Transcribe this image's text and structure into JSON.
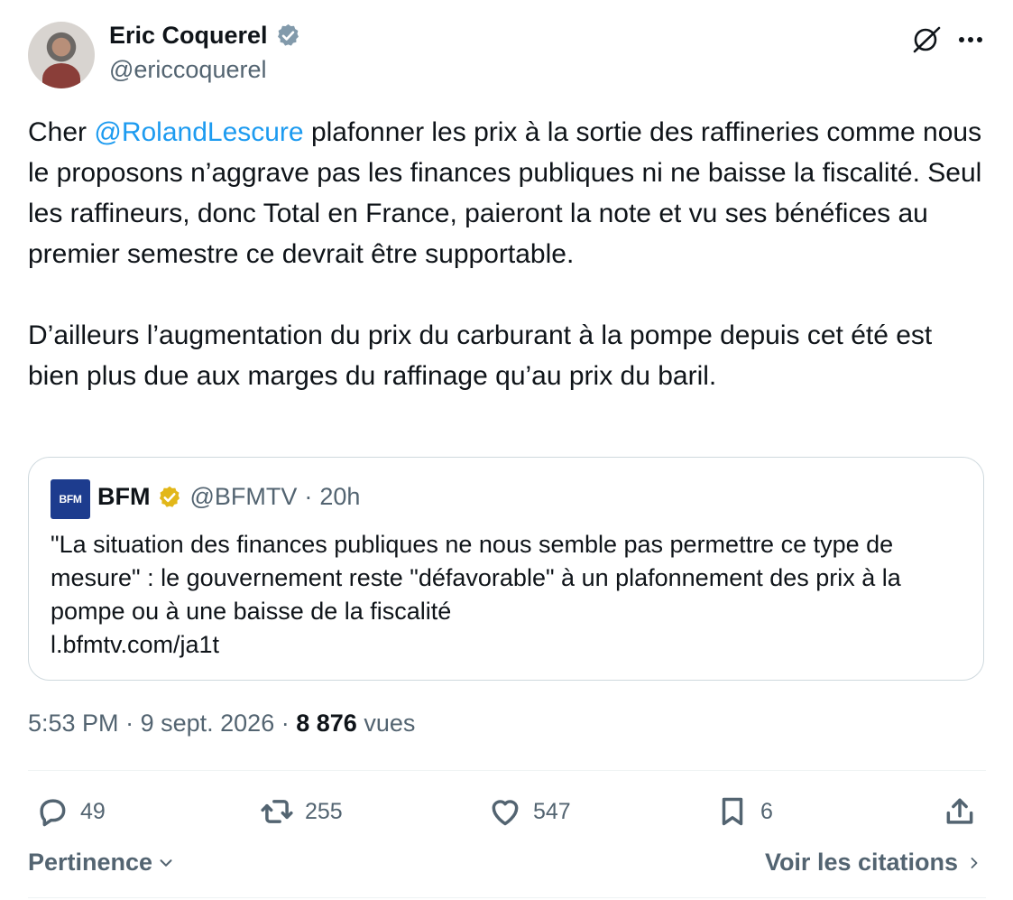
{
  "author": {
    "name": "Eric Coquerel",
    "handle": "@ericcoquerel",
    "verified_color": "#829aab"
  },
  "tweet": {
    "prefix": "Cher ",
    "mention": "@RolandLescure",
    "body": " plafonner les prix à la sortie des raffineries comme nous le proposons n’aggrave pas les finances publiques ni ne baisse la fiscalité. Seul les raffineurs, donc Total en France, paieront la note et vu ses bénéfices au premier semestre ce devrait être supportable.\n\nD’ailleurs l’augmentation du prix du carburant à la pompe depuis cet été est bien plus due aux marges du raffinage qu’au prix du baril."
  },
  "quote": {
    "logo_text": "BFM",
    "name": "BFM",
    "handle": "@BFMTV",
    "separator": "·",
    "time": "20h",
    "text": "\"La situation des finances publiques ne nous semble pas permettre ce type de mesure\" : le gouvernement reste \"défavorable\" à un plafonnement des prix à la pompe ou à une baisse de la fiscalité\nl.bfmtv.com/ja1t",
    "verified_color": "#e2b719"
  },
  "meta": {
    "time": "5:53 PM",
    "date": "9 sept. 2026",
    "separator": "·",
    "views_count": "8 876",
    "views_label": "vues"
  },
  "actions": {
    "replies": "49",
    "reposts": "255",
    "likes": "547",
    "bookmarks": "6"
  },
  "footer": {
    "sort_label": "Pertinence",
    "quotes_label": "Voir les citations"
  },
  "colors": {
    "accent": "#1d9bf0",
    "muted": "#536471",
    "text": "#0f1419",
    "border": "#cfd9de"
  }
}
